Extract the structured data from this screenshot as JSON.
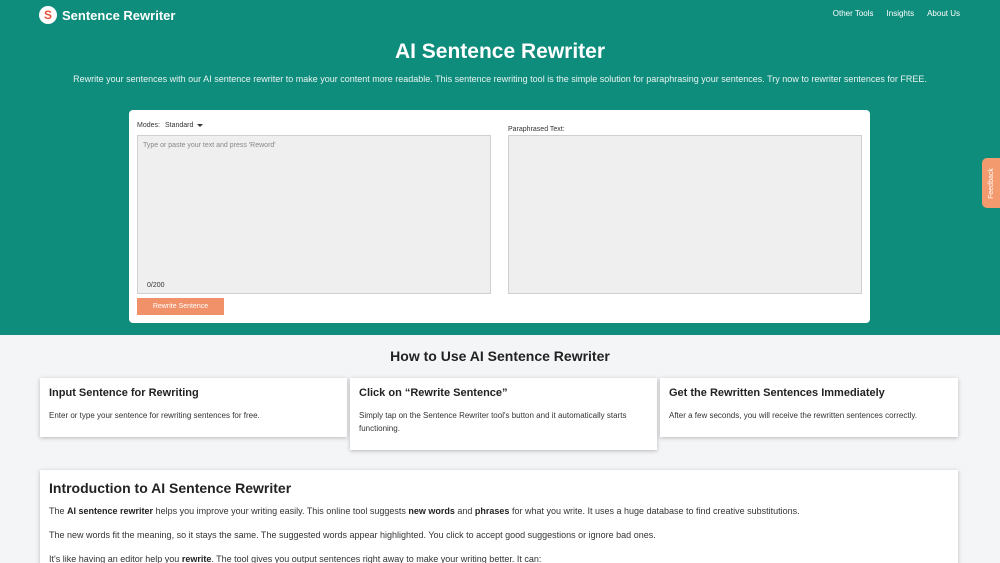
{
  "brand": {
    "logo_letter": "S",
    "name": "Sentence Rewriter"
  },
  "nav": {
    "items": [
      "Other Tools",
      "Insights",
      "About Us"
    ]
  },
  "hero": {
    "title": "AI Sentence Rewriter",
    "subtitle": "Rewrite your sentences with our AI sentence rewriter to make your content more readable. This sentence rewriting tool is the simple solution for paraphrasing your sentences. Try now to rewriter sentences for FREE."
  },
  "editor": {
    "modes_label": "Modes:",
    "mode_value": "Standard",
    "placeholder": "Type or paste your text and press 'Reword'",
    "char_count": "0/200",
    "output_label": "Paraphrased Text:",
    "button_label": "Rewrite Sentence"
  },
  "feedback_label": "Feedback",
  "how": {
    "title": "How to Use AI Sentence Rewriter",
    "steps": [
      {
        "title": "Input Sentence for Rewriting",
        "text": "Enter or type your sentence for rewriting sentences for free."
      },
      {
        "title": "Click on “Rewrite Sentence”",
        "text": "Simply tap on the Sentence Rewriter tool's button and it automatically starts functioning."
      },
      {
        "title": "Get the Rewritten Sentences Immediately",
        "text": "After a few seconds, you will receive the rewritten sentences correctly."
      }
    ]
  },
  "intro": {
    "title": "Introduction to AI Sentence Rewriter",
    "p1": {
      "a": "The ",
      "b": "AI sentence rewriter",
      "c": " helps you improve your writing easily. This online tool suggests ",
      "d": "new words",
      "e": " and ",
      "f": "phrases",
      "g": " for what you write. It uses a huge database to find creative substitutions."
    },
    "p2": "The new words fit the meaning, so it stays the same. The suggested words appear highlighted. You click to accept good suggestions or ignore bad ones.",
    "p3": {
      "a": "It's like having an editor help you ",
      "b": "rewrite",
      "c": ". The tool gives you output sentences right away to make your writing better. It can:"
    }
  },
  "colors": {
    "hero_bg": "#0e8c7c",
    "button": "#f0916a",
    "feedback": "#f39a6f",
    "logo_accent": "#e8553a"
  }
}
